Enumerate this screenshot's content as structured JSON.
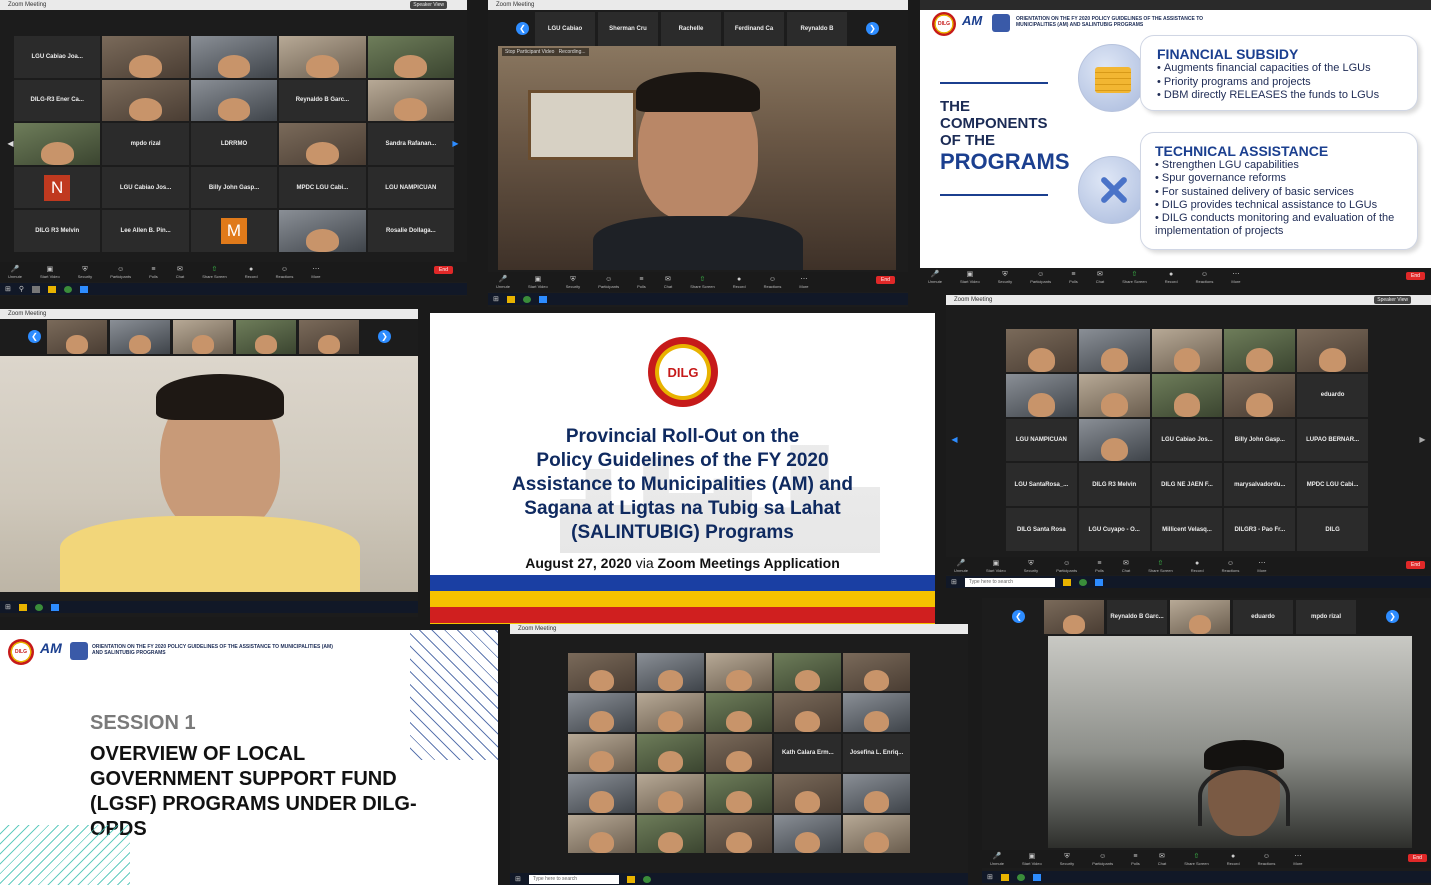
{
  "zoom": {
    "window_title": "Zoom Meeting",
    "speaker_view": "Speaker View",
    "toolbar": [
      "Unmute",
      "Start Video",
      "Security",
      "Participants",
      "Polls",
      "Chat",
      "Share Screen",
      "Record",
      "Reactions",
      "More"
    ],
    "end": "End"
  },
  "panel_a": {
    "rows": [
      [
        "LGU Cabiao Joa...",
        "",
        "",
        "",
        ""
      ],
      [
        "DILG-R3 Ener Ca...",
        "",
        "",
        "Reynaldo B Garc...",
        ""
      ],
      [
        "",
        "mpdo rizal",
        "LDRRMO",
        "",
        "Sandra Rafanan..."
      ],
      [
        "N",
        "LGU Cabiao Jos...",
        "Billy John Gasp...",
        "MPDC LGU Cabi...",
        "LGU NAMPICUAN"
      ],
      [
        "DILG R3 Melvin",
        "Lee Allen B. Pin...",
        "M",
        "",
        "Rosalie Dollaga..."
      ]
    ]
  },
  "panel_b": {
    "strip": [
      "LGU Cabiao",
      "Sherman Cru",
      "Rachelle",
      "Ferdinand Ca",
      "Reynaldo B"
    ],
    "stopped_video": "Stop Participant Video",
    "recording": "Recording..."
  },
  "comp_slide": {
    "header": "ORIENTATION ON THE FY 2020 POLICY GUIDELINES OF THE ASSISTANCE TO MUNICIPALITIES (AM) AND SALINTUBIG PROGRAMS",
    "title_line1": "THE",
    "title_line2": "COMPONENTS",
    "title_line3": "OF THE",
    "title_line4": "PROGRAMS",
    "logo_dilg": "DILG",
    "logo_am": "AM",
    "financial": {
      "heading": "FINANCIAL SUBSIDY",
      "items": [
        "Augments financial capacities of the LGUs",
        "Priority programs and projects",
        "DBM directly RELEASES the funds to LGUs"
      ]
    },
    "technical": {
      "heading": "TECHNICAL ASSISTANCE",
      "items": [
        "Strengthen LGU capabilities",
        "Spur governance reforms",
        "For sustained delivery of basic services",
        "DILG provides technical assistance to LGUs",
        "DILG conducts monitoring and evaluation of the implementation of projects"
      ]
    }
  },
  "center_slide": {
    "logo": "DILG",
    "title_lines": [
      "Provincial Roll-Out on the",
      "Policy Guidelines of the FY 2020",
      "Assistance to Municipalities (AM) and",
      "Sagana at Ligtas na Tubig sa Lahat",
      "(SALINTUBIG) Programs"
    ],
    "date": "August 27, 2020",
    "via": " via ",
    "app": "Zoom Meetings Application",
    "stripe_colors": [
      "#1a3fa3",
      "#f5c200",
      "#d01f1f",
      "#f5c200"
    ]
  },
  "panel_e": {
    "rows": [
      [
        "",
        "",
        "",
        "",
        ""
      ],
      [
        "",
        "",
        "",
        "",
        "eduardo"
      ],
      [
        "LGU NAMPICUAN",
        "",
        "LGU Cabiao Jos...",
        "Billy John Gasp...",
        "LUPAO BERNAR..."
      ],
      [
        "LGU SantaRosa_...",
        "DILG R3 Melvin",
        "DILG NE JAEN F...",
        "marysalvadordu...",
        "MPDC LGU Cabi..."
      ],
      [
        "DILG Santa Rosa",
        "LGU Cuyapo - O...",
        "Millicent Velasq...",
        "DILGR3 - Pao Fr...",
        "DILG"
      ]
    ],
    "search": "Type here to search"
  },
  "panel_f": {
    "strip": [
      "",
      "Reynaldo B Garc...",
      "",
      "eduardo",
      "mpdo rizal"
    ]
  },
  "panel_g": {
    "strip": [
      "",
      "",
      "",
      "",
      ""
    ]
  },
  "session_slide": {
    "header": "ORIENTATION ON THE FY 2020 POLICY GUIDELINES OF THE ASSISTANCE TO MUNICIPALITIES (AM) AND SALINTUBIG PROGRAMS",
    "session_label": "SESSION 1",
    "title_lines": [
      "OVERVIEW OF LOCAL",
      "GOVERNMENT SUPPORT FUND",
      "(LGSF) PROGRAMS UNDER DILG-",
      "OPDS"
    ],
    "logo_dilg": "DILG",
    "logo_am": "AM"
  },
  "panel_h": {
    "rows": [
      [
        "",
        "",
        "",
        "",
        ""
      ],
      [
        "",
        "",
        "",
        "",
        ""
      ],
      [
        "",
        "",
        "",
        "Kath Calara Erm...",
        "Josefina L. Enriq..."
      ],
      [
        "",
        "",
        "",
        "",
        ""
      ],
      [
        "",
        "",
        "",
        "",
        ""
      ]
    ],
    "search": "Type here to search"
  }
}
